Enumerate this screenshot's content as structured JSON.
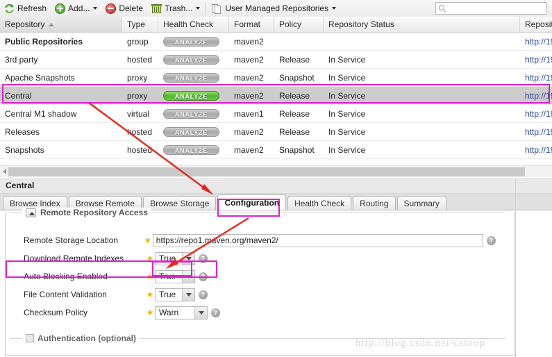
{
  "toolbar": {
    "buttons": [
      {
        "label": "Refresh",
        "icon": "refresh-icon",
        "caret": false
      },
      {
        "label": "Add...",
        "icon": "add-icon",
        "caret": true
      },
      {
        "label": "Delete",
        "icon": "delete-icon",
        "caret": false
      },
      {
        "label": "Trash...",
        "icon": "trash-icon",
        "caret": true
      },
      {
        "label": "User Managed Repositories",
        "icon": "pages-icon",
        "caret": true
      }
    ],
    "search": {
      "value": "",
      "placeholder": "",
      "icon": "search-icon"
    }
  },
  "grid": {
    "columns": [
      {
        "label": "Repository",
        "sorted": true,
        "sort_dir": "asc"
      },
      {
        "label": "Type",
        "sorted": false
      },
      {
        "label": "Health Check",
        "sorted": false
      },
      {
        "label": "Format",
        "sorted": false
      },
      {
        "label": "Policy",
        "sorted": false
      },
      {
        "label": "Repository Status",
        "sorted": false
      },
      {
        "label": "Reposit",
        "sorted": false
      }
    ],
    "health_check_label": "ANALYZE",
    "rows": [
      {
        "repository": "Public Repositories",
        "type": "group",
        "health": "grey",
        "format": "maven2",
        "policy": "",
        "status": "",
        "url": "http://19",
        "bold": true,
        "selected": false
      },
      {
        "repository": "3rd party",
        "type": "hosted",
        "health": "grey",
        "format": "maven2",
        "policy": "Release",
        "status": "In Service",
        "url": "http://19",
        "bold": false,
        "selected": false
      },
      {
        "repository": "Apache Snapshots",
        "type": "proxy",
        "health": "grey",
        "format": "maven2",
        "policy": "Snapshot",
        "status": "In Service",
        "url": "http://19",
        "bold": false,
        "selected": false
      },
      {
        "repository": "Central",
        "type": "proxy",
        "health": "green",
        "format": "maven2",
        "policy": "Release",
        "status": "In Service",
        "url": "http://19",
        "bold": false,
        "selected": true
      },
      {
        "repository": "Central M1 shadow",
        "type": "virtual",
        "health": "grey",
        "format": "maven1",
        "policy": "Release",
        "status": "In Service",
        "url": "http://19",
        "bold": false,
        "selected": false
      },
      {
        "repository": "Releases",
        "type": "hosted",
        "health": "grey",
        "format": "maven2",
        "policy": "Release",
        "status": "In Service",
        "url": "http://19",
        "bold": false,
        "selected": false
      },
      {
        "repository": "Snapshots",
        "type": "hosted",
        "health": "grey",
        "format": "maven2",
        "policy": "Snapshot",
        "status": "In Service",
        "url": "http://19",
        "bold": false,
        "selected": false
      }
    ]
  },
  "detail": {
    "title": "Central",
    "tabs": [
      {
        "label": "Browse Index",
        "active": false,
        "highlight": false
      },
      {
        "label": "Browse Remote",
        "active": false,
        "highlight": false
      },
      {
        "label": "Browse Storage",
        "active": false,
        "highlight": false
      },
      {
        "label": "Configuration",
        "active": true,
        "highlight": true
      },
      {
        "label": "Health Check",
        "active": false,
        "highlight": false
      },
      {
        "label": "Routing",
        "active": false,
        "highlight": false
      },
      {
        "label": "Summary",
        "active": false,
        "highlight": false
      }
    ],
    "section_title": "Remote Repository Access",
    "fields": [
      {
        "label": "Remote Storage Location",
        "kind": "text",
        "value": "https://repo1.maven.org/maven2/",
        "required": true,
        "help": "?",
        "highlight": false
      },
      {
        "label": "Download Remote Indexes",
        "kind": "select",
        "value": "True",
        "required": true,
        "help": "?",
        "highlight": true
      },
      {
        "label": "Auto Blocking Enabled",
        "kind": "select",
        "value": "True",
        "required": true,
        "help": "?",
        "highlight": false
      },
      {
        "label": "File Content Validation",
        "kind": "select",
        "value": "True",
        "required": true,
        "help": "?",
        "highlight": false
      },
      {
        "label": "Checksum Policy",
        "kind": "select",
        "value": "Warn",
        "required": true,
        "help": "?",
        "highlight": false
      }
    ],
    "auth_section": {
      "label": "Authentication (optional)",
      "checked": false
    }
  },
  "annotations": {
    "highlight_color": "#e020d0",
    "arrow_color": "#e8271c",
    "watermark": "http://blog.csdn.net/catoop"
  }
}
